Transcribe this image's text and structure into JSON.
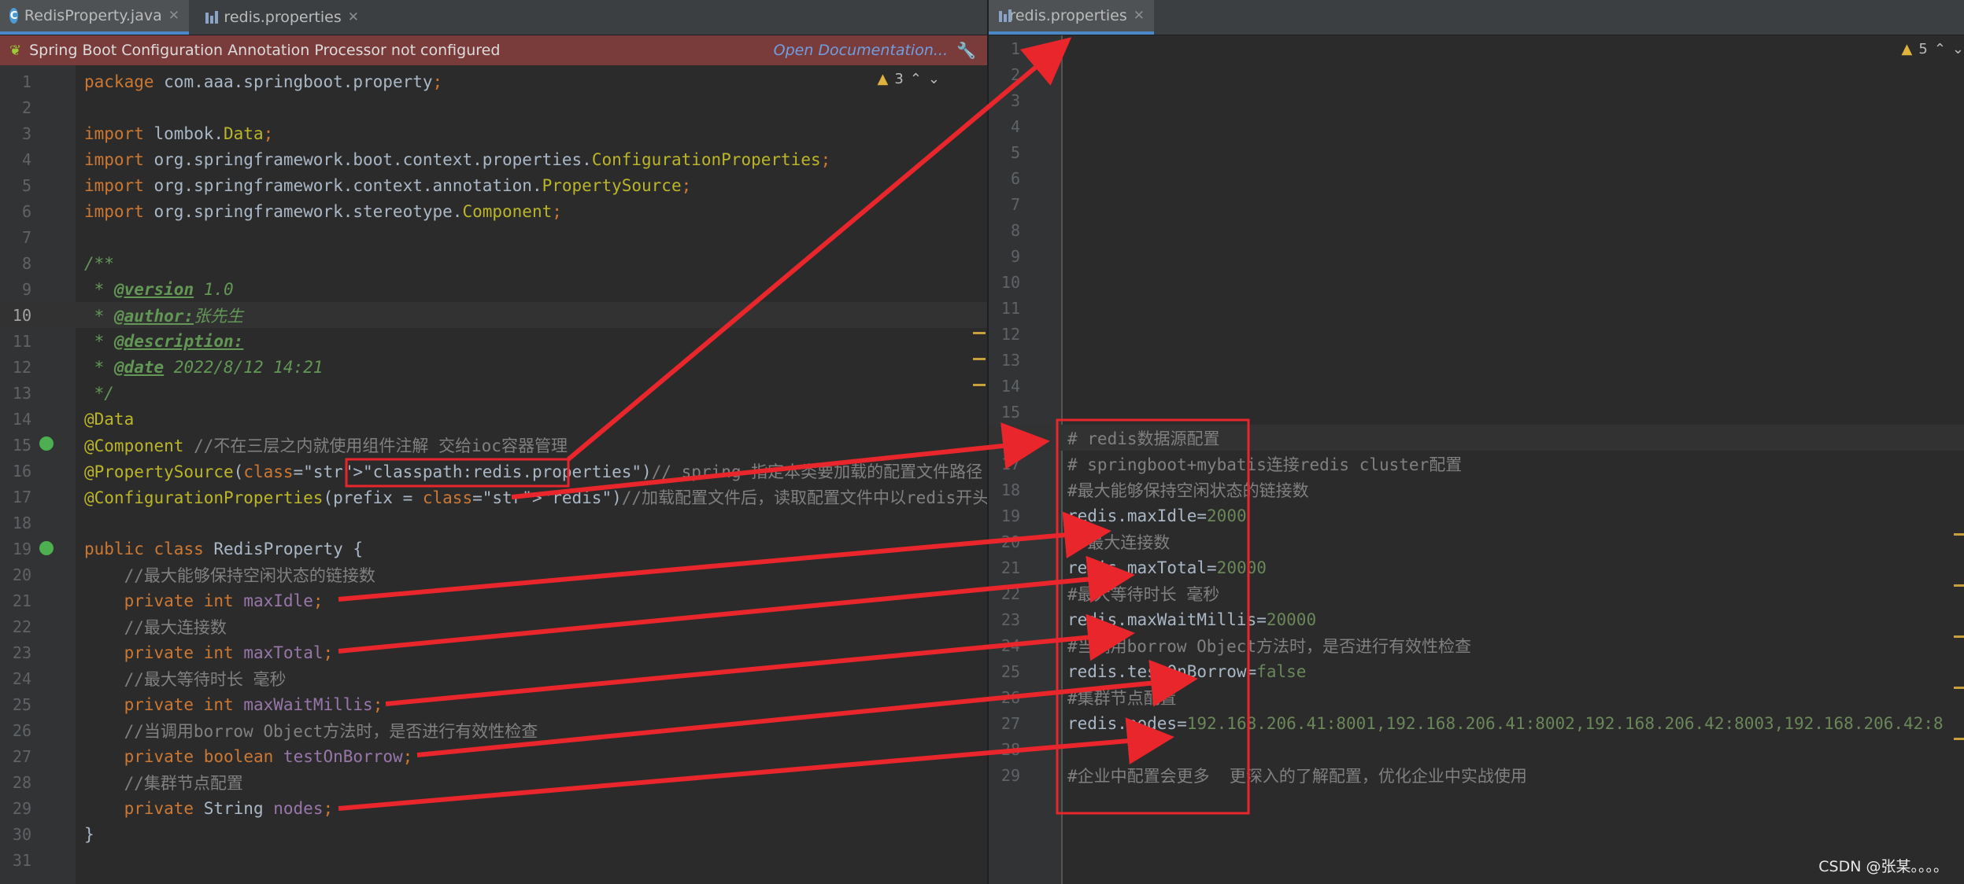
{
  "left_tabs": [
    {
      "label": "RedisProperty.java",
      "icon": "java-class-icon"
    },
    {
      "label": "redis.properties",
      "icon": "properties-file-icon"
    }
  ],
  "right_tabs": [
    {
      "label": "redis.properties",
      "icon": "properties-file-icon"
    }
  ],
  "banner": {
    "message": "Spring Boot Configuration Annotation Processor not configured",
    "link": "Open Documentation...",
    "icon": "wrench-icon"
  },
  "left_warnings": {
    "count": "3"
  },
  "right_warnings": {
    "count": "5"
  },
  "left_editor": {
    "current_line": 10,
    "lines": [
      "package com.aaa.springboot.property;",
      "",
      "import lombok.Data;",
      "import org.springframework.boot.context.properties.ConfigurationProperties;",
      "import org.springframework.context.annotation.PropertySource;",
      "import org.springframework.stereotype.Component;",
      "",
      "/**",
      " * @version 1.0",
      " * @author:张先生",
      " * @description:",
      " * @date 2022/8/12 14:21",
      " */",
      "@Data",
      "@Component //不在三层之内就使用组件注解 交给ioc容器管理",
      "@PropertySource(\"classpath:redis.properties\")// spring 指定本类要加载的配置文件路径",
      "@ConfigurationProperties(prefix = \"redis\")//加载配置文件后，读取配置文件中以redis开头的配置 和本类",
      "",
      "public class RedisProperty {",
      "    //最大能够保持空闲状态的链接数",
      "    private int maxIdle;",
      "    //最大连接数",
      "    private int maxTotal;",
      "    //最大等待时长 毫秒",
      "    private int maxWaitMillis;",
      "    //当调用borrow Object方法时，是否进行有效性检查",
      "    private boolean testOnBorrow;",
      "    //集群节点配置",
      "    private String nodes;",
      "}",
      ""
    ]
  },
  "right_editor": {
    "current_line": 16,
    "lines": [
      "",
      "",
      "",
      "",
      "",
      "",
      "",
      "",
      "",
      "",
      "",
      "",
      "",
      "",
      "",
      "# redis数据源配置",
      "# springboot+mybatis连接redis cluster配置",
      "#最大能够保持空闲状态的链接数",
      "redis.maxIdle=2000",
      "# 最大连接数",
      "redis.maxTotal=20000",
      "#最大等待时长 毫秒",
      "redis.maxWaitMillis=20000",
      "#当调用borrow Object方法时，是否进行有效性检查",
      "redis.testOnBorrow=false",
      "#集群节点配置",
      "redis.nodes=192.168.206.41:8001,192.168.206.41:8002,192.168.206.42:8003,192.168.206.42:8",
      "",
      "#企业中配置会更多  更深入的了解配置，优化企业中实战使用"
    ]
  },
  "watermark": "CSDN @张某。。。。",
  "colors": {
    "annotation_red": "#e8262b",
    "tab_underline": "#4a88c7",
    "banner_bg": "#7a3b3b"
  }
}
